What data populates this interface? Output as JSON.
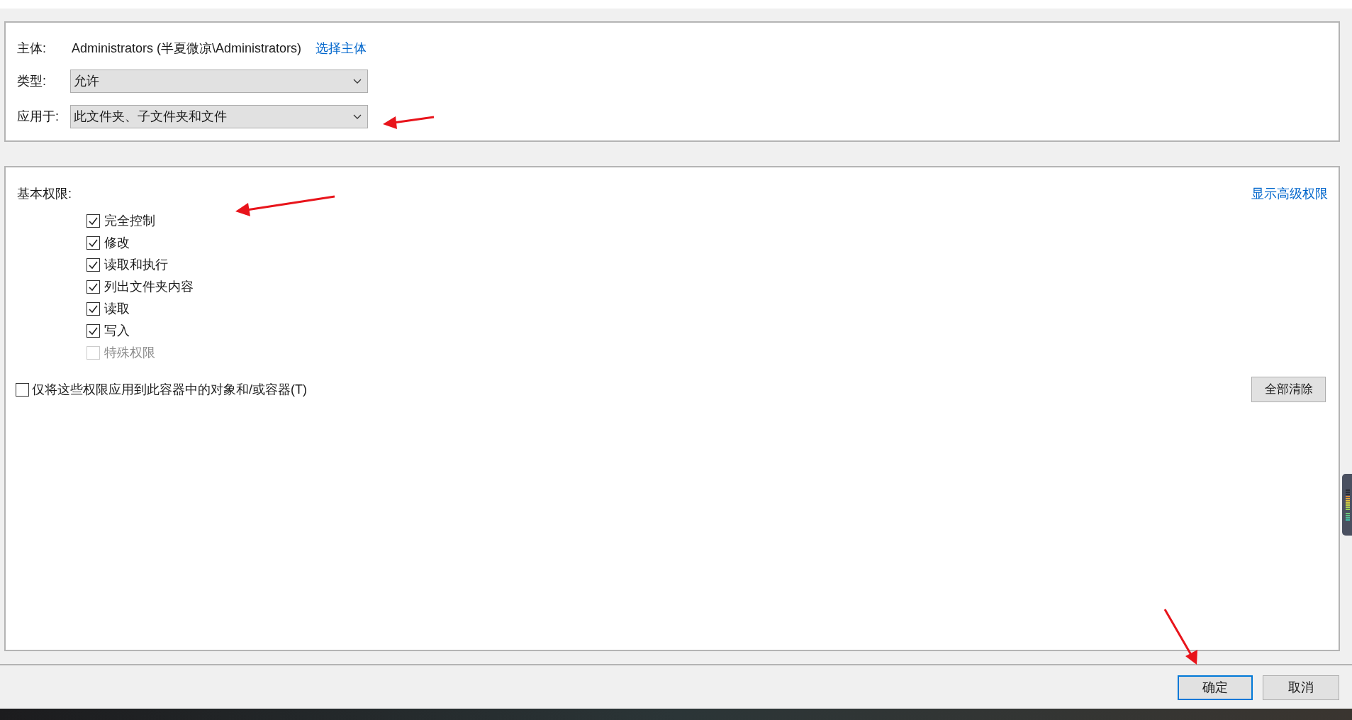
{
  "principal": {
    "label": "主体:",
    "value": "Administrators (半夏微凉\\Administrators)",
    "link": "选择主体"
  },
  "type": {
    "label": "类型:",
    "value": "允许"
  },
  "applies_to": {
    "label": "应用于:",
    "value": "此文件夹、子文件夹和文件"
  },
  "permissions": {
    "title": "基本权限:",
    "advanced_link": "显示高级权限",
    "items": [
      {
        "label": "完全控制",
        "checked": true,
        "disabled": false
      },
      {
        "label": "修改",
        "checked": true,
        "disabled": false
      },
      {
        "label": "读取和执行",
        "checked": true,
        "disabled": false
      },
      {
        "label": "列出文件夹内容",
        "checked": true,
        "disabled": false
      },
      {
        "label": "读取",
        "checked": true,
        "disabled": false
      },
      {
        "label": "写入",
        "checked": true,
        "disabled": false
      },
      {
        "label": "特殊权限",
        "checked": false,
        "disabled": true
      }
    ]
  },
  "apply_only": {
    "label": "仅将这些权限应用到此容器中的对象和/或容器(T)",
    "checked": false
  },
  "clear_button": "全部清除",
  "buttons": [
    {
      "label": "确定",
      "default": true
    },
    {
      "label": "取消",
      "default": false
    }
  ]
}
